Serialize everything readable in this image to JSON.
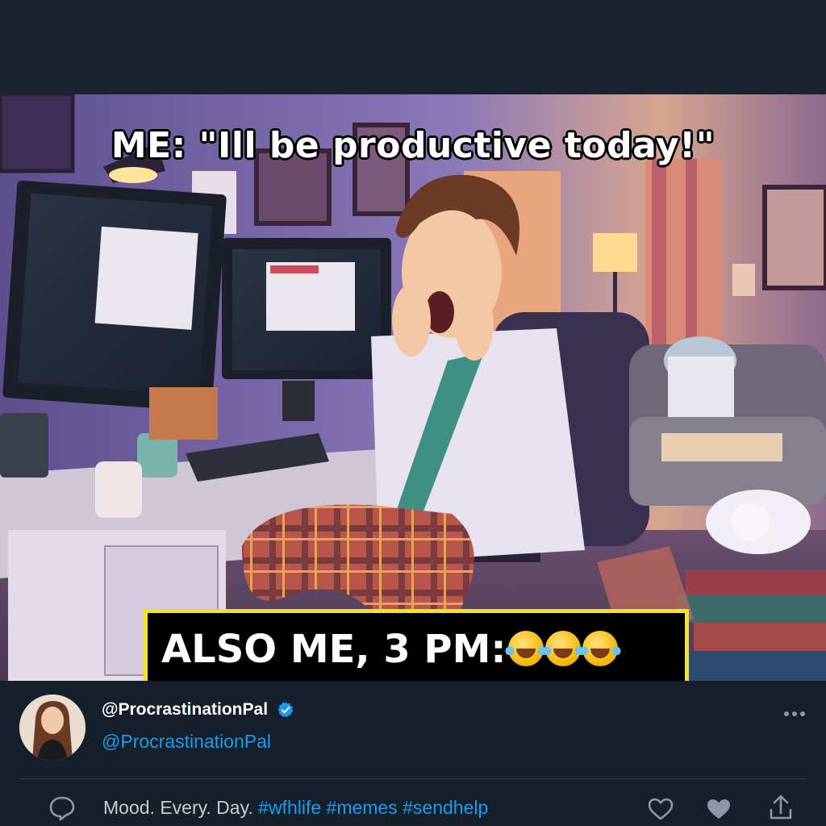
{
  "meme": {
    "top_caption": "ME: \"Ill be productive today!\"",
    "bottom_caption": "ALSO ME, 3 PM:",
    "bottom_emoji": "face-with-tears-of-joy"
  },
  "post": {
    "display_name": "@ProcrastinationPal",
    "handle": "@ProcrastinationPal",
    "text_plain": "Mood. Every. Day. ",
    "hashtags": [
      "#wfhlife",
      "#memes",
      "#sendhelp"
    ],
    "verified": true
  },
  "colors": {
    "background": "#15202b",
    "accent": "#1d9bf0",
    "caption_border": "#f2e424"
  },
  "icons": [
    "more-icon",
    "verified-icon",
    "comment-icon",
    "like-icon",
    "like-filled-icon",
    "share-icon"
  ]
}
